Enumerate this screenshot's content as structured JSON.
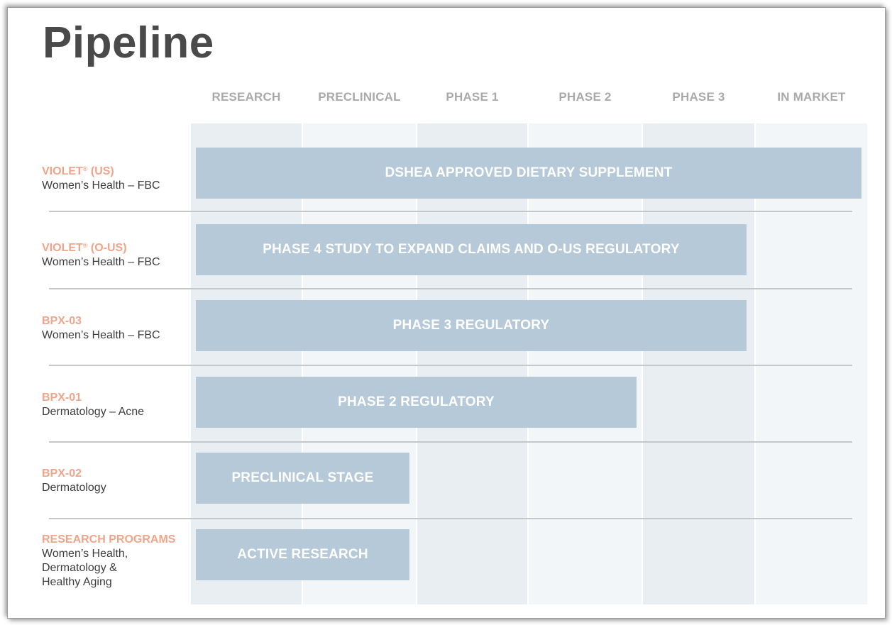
{
  "page": {
    "title": "Pipeline"
  },
  "chart_data": {
    "type": "table",
    "columns": [
      "RESEARCH",
      "PRECLINICAL",
      "PHASE 1",
      "PHASE 2",
      "PHASE 3",
      "IN MARKET"
    ],
    "band_colors": [
      "#e9eef2",
      "#f3f6f8",
      "#e9eef2",
      "#f3f6f8",
      "#e9eef2",
      "#f3f6f8"
    ],
    "rows": [
      {
        "name": "VIOLET",
        "mark": "®",
        "region": "(US)",
        "subtitle": "Women’s Health – FBC",
        "bar_label": "DSHEA APPROVED DIETARY SUPPLEMENT",
        "stages_completed": 6
      },
      {
        "name": "VIOLET",
        "mark": "®",
        "region": "(O-US)",
        "subtitle": "Women’s Health – FBC",
        "bar_label": "PHASE 4 STUDY TO EXPAND CLAIMS AND O-US REGULATORY",
        "stages_completed": 5
      },
      {
        "name": "BPX-03",
        "mark": "",
        "region": "",
        "subtitle": "Women’s Health – FBC",
        "bar_label": "PHASE 3 REGULATORY",
        "stages_completed": 5
      },
      {
        "name": "BPX-01",
        "mark": "",
        "region": "",
        "subtitle": "Dermatology – Acne",
        "bar_label": "PHASE 2 REGULATORY",
        "stages_completed": 4
      },
      {
        "name": "BPX-02",
        "mark": "",
        "region": "",
        "subtitle": "Dermatology",
        "bar_label": "PRECLINICAL STAGE",
        "stages_completed": 2
      },
      {
        "name": "RESEARCH PROGRAMS",
        "mark": "",
        "region": "",
        "subtitle": "Women’s Health,\nDermatology &\nHealthy Aging",
        "bar_label": "ACTIVE RESEARCH",
        "stages_completed": 2
      }
    ],
    "colors": {
      "bar": "#b5c9d9",
      "bar_text": "#ffffff",
      "row_name": "#f0a58a",
      "header": "#a9a9a9",
      "divider": "#c7c7c7"
    }
  }
}
